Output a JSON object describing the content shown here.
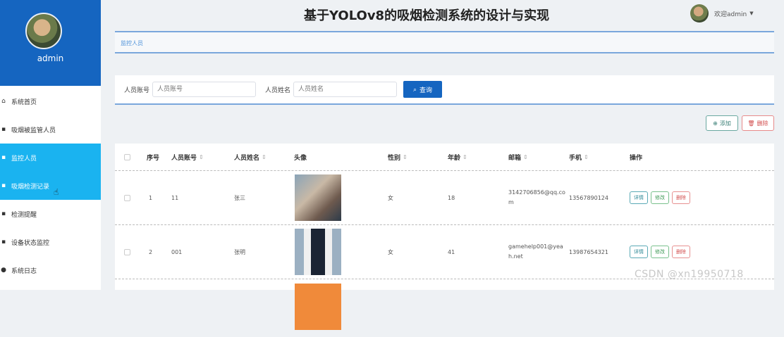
{
  "app": {
    "title": "基于YOLOv8的吸烟检测系统的设计与实现"
  },
  "user": {
    "name": "admin",
    "greeting": "欢迎admin"
  },
  "sidebar": {
    "items": [
      {
        "label": "系统首页",
        "icon": "home-icon"
      },
      {
        "label": "吸烟被监管人员",
        "icon": "grid-icon"
      },
      {
        "label": "监控人员",
        "icon": "grid-icon"
      },
      {
        "label": "吸烟检测记录",
        "icon": "grid-icon"
      },
      {
        "label": "检测提醒",
        "icon": "grid-icon"
      },
      {
        "label": "设备状态监控",
        "icon": "grid-icon"
      },
      {
        "label": "系统日志",
        "icon": "user-icon"
      }
    ],
    "active_index": 2,
    "hover_index": 3
  },
  "breadcrumb": {
    "current": "监控人员"
  },
  "search": {
    "account_label": "人员账号",
    "account_placeholder": "人员账号",
    "name_label": "人员姓名",
    "name_placeholder": "人员姓名",
    "button_label": "查询"
  },
  "actions": {
    "add_label": "添加",
    "delete_label": "删除"
  },
  "table": {
    "columns": [
      "序号",
      "人员账号",
      "人员姓名",
      "头像",
      "性别",
      "年龄",
      "邮箱",
      "手机",
      "操作"
    ],
    "rows": [
      {
        "index": "1",
        "account": "11",
        "name": "张三",
        "gender": "女",
        "age": "18",
        "email": "3142706856@qq.com",
        "phone": "13567890124"
      },
      {
        "index": "2",
        "account": "001",
        "name": "张明",
        "gender": "女",
        "age": "41",
        "email": "gamehelp001@yeah.net",
        "phone": "13987654321"
      }
    ],
    "row_actions": {
      "detail": "详情",
      "edit": "修改",
      "delete": "删除"
    }
  },
  "watermark": "CSDN @xn19950718"
}
